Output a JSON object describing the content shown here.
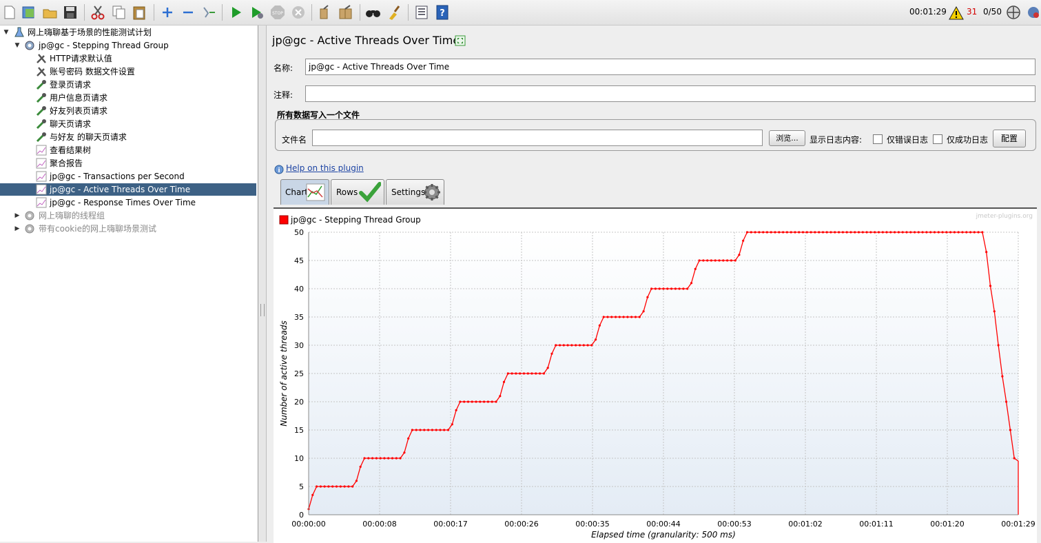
{
  "toolbar": {
    "elapsed": "00:01:29",
    "warning_count": "31",
    "threads": "0/50"
  },
  "tree": {
    "root": "网上嗨聊基于场景的性能测试计划",
    "thread_group": "jp@gc - Stepping Thread Group",
    "items": [
      "HTTP请求默认值",
      "账号密码 数据文件设置",
      "登录页请求",
      "用户信息页请求",
      "好友列表页请求",
      "聊天页请求",
      "与好友 的聊天页请求",
      "查看结果树",
      "聚合报告",
      "jp@gc - Transactions per Second",
      "jp@gc - Active Threads Over Time",
      "jp@gc - Response Times Over Time"
    ],
    "other_groups": [
      "网上嗨聊的线程组",
      "带有cookie的网上嗨聊场景测试"
    ]
  },
  "panel": {
    "title": "jp@gc - Active Threads Over Time",
    "name_label": "名称:",
    "name_value": "jp@gc - Active Threads Over Time",
    "comment_label": "注释:",
    "comment_value": "",
    "file_section_title": "所有数据写入一个文件",
    "filename_label": "文件名",
    "filename_value": "",
    "browse_button": "浏览...",
    "log_content_label": "显示日志内容:",
    "errors_only_label": "仅错误日志",
    "success_only_label": "仅成功日志",
    "configure_button": "配置",
    "help_link": "Help on this plugin",
    "tabs": [
      "Chart",
      "Rows",
      "Settings"
    ]
  },
  "chart_data": {
    "type": "line",
    "watermark": "jmeter-plugins.org",
    "xlabel": "Elapsed time (granularity: 500 ms)",
    "ylabel": "Number of active threads",
    "ylim": [
      0,
      50
    ],
    "yticks": [
      0,
      5,
      10,
      15,
      20,
      25,
      30,
      35,
      40,
      45,
      50
    ],
    "xlim": [
      0,
      89
    ],
    "xticks": [
      "00:00:00",
      "00:00:08",
      "00:00:17",
      "00:00:26",
      "00:00:35",
      "00:00:44",
      "00:00:53",
      "00:01:02",
      "00:01:11",
      "00:01:20",
      "00:01:29"
    ],
    "grid": true,
    "legend": "top-left",
    "series": [
      {
        "name": "jp@gc - Stepping Thread Group",
        "color": "#ff0000",
        "x": [
          0,
          0.5,
          1,
          5.5,
          6,
          6.5,
          7,
          11.5,
          12,
          12.5,
          13,
          17.5,
          18,
          18.5,
          19,
          23.5,
          24,
          24.5,
          25,
          29.5,
          30,
          30.5,
          31,
          35.5,
          36,
          36.5,
          37,
          41.5,
          42,
          42.5,
          43,
          47.5,
          48,
          48.5,
          49,
          53.5,
          54,
          54.5,
          55,
          84.5,
          85,
          85.5,
          86,
          86.5,
          87,
          87.5,
          88,
          88.5,
          89,
          89
        ],
        "y": [
          1,
          3.5,
          5,
          5,
          6,
          8.5,
          10,
          10,
          11,
          13.5,
          15,
          15,
          16,
          18.5,
          20,
          20,
          21,
          23.5,
          25,
          25,
          26,
          28.5,
          30,
          30,
          31,
          33.5,
          35,
          35,
          36,
          38.5,
          40,
          40,
          41,
          43.5,
          45,
          45,
          46,
          48.5,
          50,
          50,
          46.5,
          40.5,
          36,
          30,
          24.5,
          20,
          15,
          10,
          9.5,
          0
        ]
      }
    ]
  }
}
